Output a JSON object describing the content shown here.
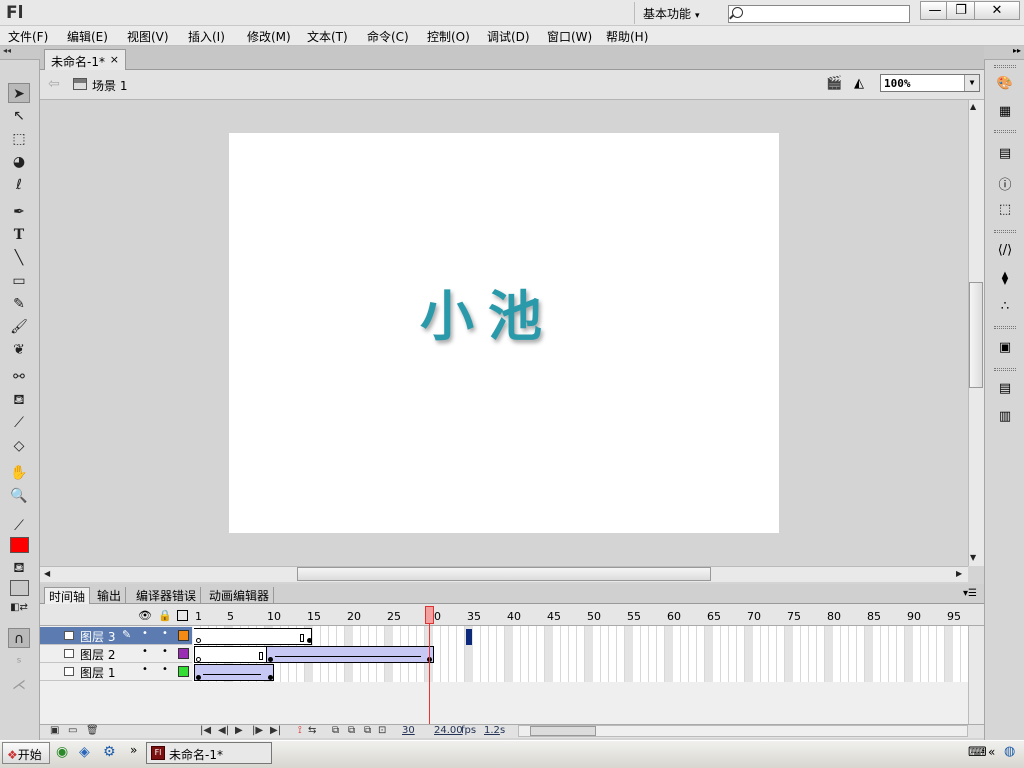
{
  "app": {
    "logo": "Fl",
    "workspace": "基本功能",
    "search_placeholder": ""
  },
  "window_buttons": {
    "minimize": "—",
    "restore": "❐",
    "close": "✕"
  },
  "menu": [
    "文件(F)",
    "编辑(E)",
    "视图(V)",
    "插入(I)",
    "修改(M)",
    "文本(T)",
    "命令(C)",
    "控制(O)",
    "调试(D)",
    "窗口(W)",
    "帮助(H)"
  ],
  "document": {
    "tab_title": "未命名-1*",
    "close": "×",
    "scene": "场景 1",
    "zoom": "100%"
  },
  "stage": {
    "text": "小池",
    "text_color": "#2a9aaa",
    "background": "#ffffff"
  },
  "timeline": {
    "tabs": [
      "时间轴",
      "输出",
      "编译器错误",
      "动画编辑器"
    ],
    "ruler": [
      "1",
      "5",
      "10",
      "15",
      "20",
      "25",
      "30",
      "35",
      "40",
      "45",
      "50",
      "55",
      "60",
      "65",
      "70",
      "75",
      "80",
      "85",
      "90",
      "95"
    ],
    "current_frame": "30",
    "layers": [
      {
        "name": "图层 3",
        "color": "#f28a14",
        "selected": true
      },
      {
        "name": "图层 2",
        "color": "#9a2fb4",
        "selected": false
      },
      {
        "name": "图层 1",
        "color": "#33dd33",
        "selected": false
      }
    ],
    "footer": {
      "frame": "30",
      "fps": "24.00",
      "fps_unit": "fps",
      "time": "1.2",
      "time_unit": "s"
    }
  },
  "tools": {
    "fill_color": "#ff0000",
    "stroke_color": "#000000"
  },
  "taskbar": {
    "start": "开始",
    "window_title": "未命名-1*",
    "more": "»"
  }
}
